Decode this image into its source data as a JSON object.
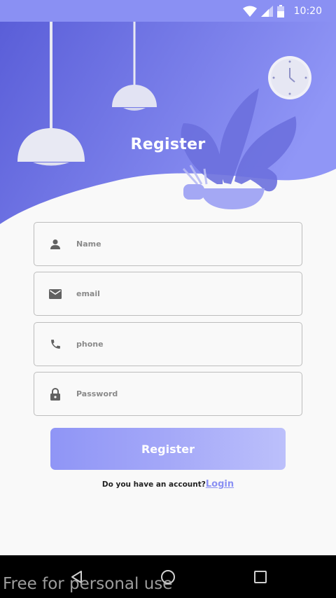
{
  "status_bar": {
    "time": "10:20",
    "icons": [
      "wifi-icon",
      "signal-icon",
      "battery-icon"
    ]
  },
  "header": {
    "title": "Register",
    "illustration": [
      "pendant-lamp-large",
      "pendant-lamp-small",
      "wall-clock",
      "potted-plant"
    ]
  },
  "form": {
    "name_placeholder": "Name",
    "email_placeholder": "email",
    "phone_placeholder": "phone",
    "password_placeholder": "Password",
    "name_icon": "person-icon",
    "email_icon": "mail-icon",
    "phone_icon": "phone-icon",
    "password_icon": "lock-icon"
  },
  "register_button": {
    "label": "Register"
  },
  "footer": {
    "question": "Do you have an account?",
    "login_label": "Login"
  },
  "nav_bar": {
    "icons": [
      "back-icon",
      "home-icon",
      "recents-icon"
    ]
  },
  "watermark": "Free for personal use",
  "colors": {
    "accent": "#8a90f3",
    "header_gradient_start": "#5c60d9",
    "header_gradient_end": "#8d93f5",
    "background": "#f9f9f9"
  }
}
